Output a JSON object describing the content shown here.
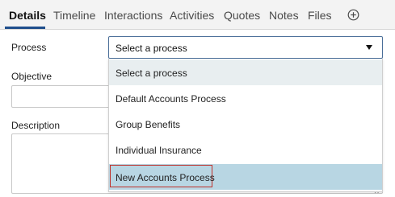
{
  "tabs": [
    {
      "label": "Details",
      "active": true
    },
    {
      "label": "Timeline",
      "active": false
    },
    {
      "label": "Interactions",
      "active": false
    },
    {
      "label": "Activities",
      "active": false
    },
    {
      "label": "Quotes",
      "active": false
    },
    {
      "label": "Notes",
      "active": false
    },
    {
      "label": "Files",
      "active": false
    }
  ],
  "add_tab_icon": "plus-circle-icon",
  "form": {
    "process_label": "Process",
    "objective_label": "Objective",
    "description_label": "Description",
    "process_select": {
      "value": "Select a process",
      "options": [
        "Select a process",
        "Default Accounts Process",
        "Group Benefits",
        "Individual Insurance",
        "New Accounts Process"
      ],
      "hovered_option": "New Accounts Process"
    }
  },
  "colors": {
    "accent": "#1f4e8c",
    "hover_row": "#b8d6e3",
    "highlight_outline": "#c0312b"
  }
}
